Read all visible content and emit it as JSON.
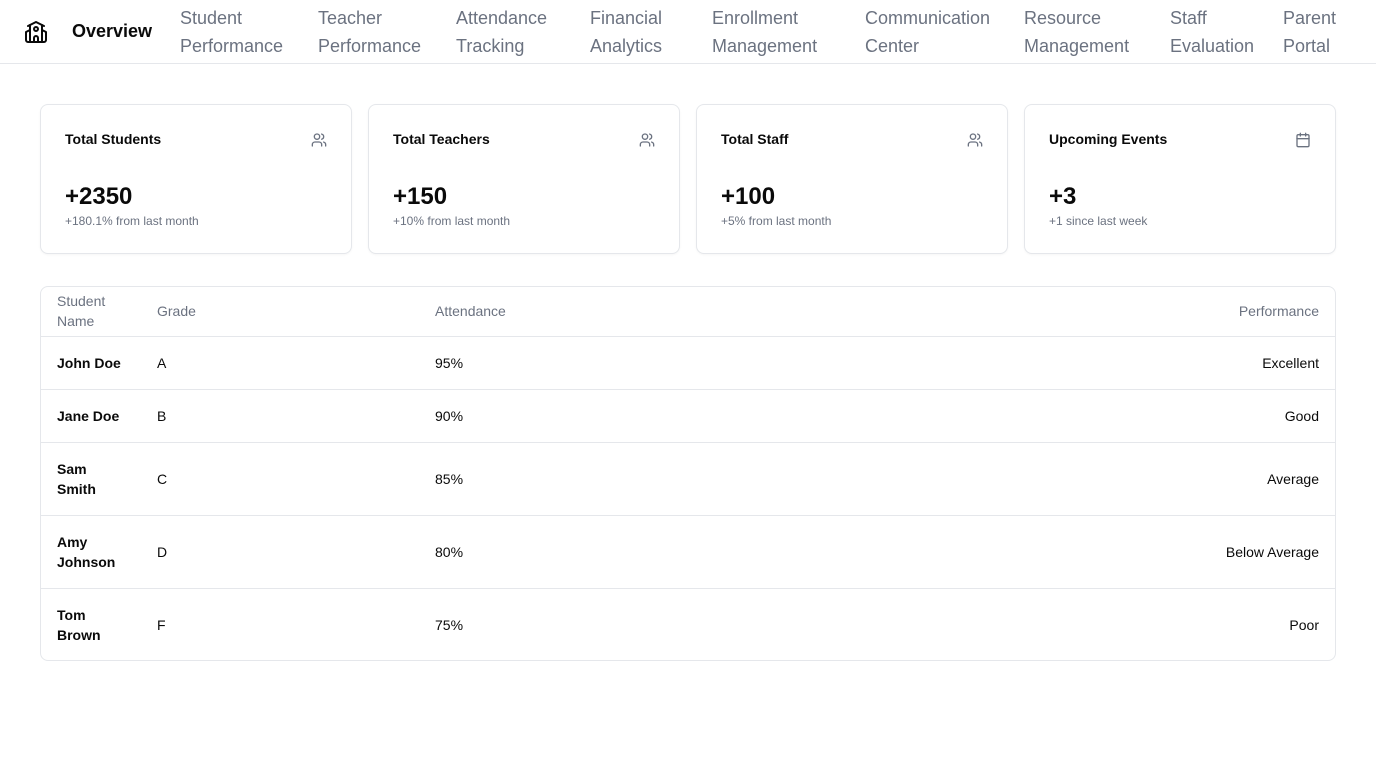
{
  "nav": {
    "logo_icon": "school-icon",
    "items": [
      {
        "label": "Overview",
        "lines": [
          "Overview"
        ],
        "active": true
      },
      {
        "label": "Student Performance",
        "lines": [
          "Student",
          "Performance"
        ]
      },
      {
        "label": "Teacher Performance",
        "lines": [
          "Teacher",
          "Performance"
        ]
      },
      {
        "label": "Attendance Tracking",
        "lines": [
          "Attendance",
          "Tracking"
        ]
      },
      {
        "label": "Financial Analytics",
        "lines": [
          "Financial",
          "Analytics"
        ]
      },
      {
        "label": "Enrollment Management",
        "lines": [
          "Enrollment",
          "Management"
        ]
      },
      {
        "label": "Communication Center",
        "lines": [
          "Communication",
          "Center"
        ]
      },
      {
        "label": "Resource Management",
        "lines": [
          "Resource",
          "Management"
        ]
      },
      {
        "label": "Staff Evaluation",
        "lines": [
          "Staff",
          "Evaluation"
        ]
      },
      {
        "label": "Parent Portal",
        "lines": [
          "Parent",
          "Portal"
        ]
      }
    ]
  },
  "cards": [
    {
      "title": "Total Students",
      "value": "+2350",
      "sub": "+180.1% from last month",
      "icon": "users-icon"
    },
    {
      "title": "Total Teachers",
      "value": "+150",
      "sub": "+10% from last month",
      "icon": "users-icon"
    },
    {
      "title": "Total Staff",
      "value": "+100",
      "sub": "+5% from last month",
      "icon": "users-icon"
    },
    {
      "title": "Upcoming Events",
      "value": "+3",
      "sub": "+1 since last week",
      "icon": "calendar-icon"
    }
  ],
  "table": {
    "headers": [
      "Student Name",
      "Grade",
      "Attendance",
      "Performance"
    ],
    "rows": [
      {
        "name": "John Doe",
        "grade": "A",
        "attendance": "95%",
        "performance": "Excellent"
      },
      {
        "name": "Jane Doe",
        "grade": "B",
        "attendance": "90%",
        "performance": "Good"
      },
      {
        "name": "Sam Smith",
        "grade": "C",
        "attendance": "85%",
        "performance": "Average"
      },
      {
        "name": "Amy Johnson",
        "grade": "D",
        "attendance": "80%",
        "performance": "Below Average"
      },
      {
        "name": "Tom Brown",
        "grade": "F",
        "attendance": "75%",
        "performance": "Poor"
      }
    ]
  },
  "colors": {
    "text": "#0a0a0a",
    "muted": "#6b7280",
    "border": "#e5e7eb"
  }
}
